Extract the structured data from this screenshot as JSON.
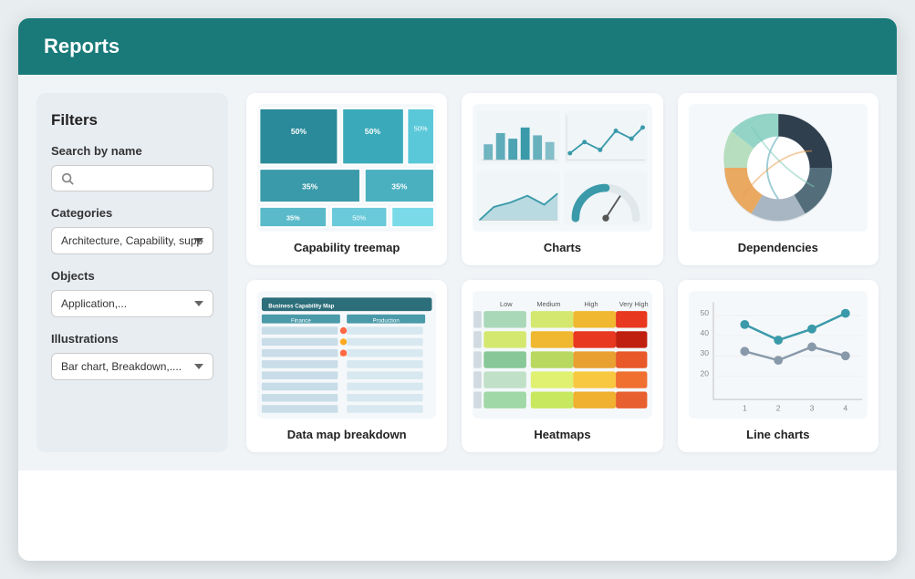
{
  "header": {
    "title": "Reports"
  },
  "sidebar": {
    "title": "Filters",
    "search": {
      "label": "Search by name",
      "placeholder": ""
    },
    "categories": {
      "label": "Categories",
      "value": "Architecture, Capability, support, ..."
    },
    "objects": {
      "label": "Objects",
      "value": "Application,..."
    },
    "illustrations": {
      "label": "Illustrations",
      "value": "Bar chart, Breakdown,...."
    }
  },
  "reports": [
    {
      "id": "capability-treemap",
      "label": "Capability treemap",
      "type": "treemap"
    },
    {
      "id": "charts",
      "label": "Charts",
      "type": "charts"
    },
    {
      "id": "dependencies",
      "label": "Dependencies",
      "type": "dependencies"
    },
    {
      "id": "data-map-breakdown",
      "label": "Data map breakdown",
      "type": "datamap"
    },
    {
      "id": "heatmaps",
      "label": "Heatmaps",
      "type": "heatmap"
    },
    {
      "id": "line-charts",
      "label": "Line charts",
      "type": "linechart"
    }
  ],
  "colors": {
    "header_bg": "#1a7a7a",
    "sidebar_bg": "#e8edf2",
    "card_bg": "#ffffff",
    "treemap_dark": "#1a6a7a",
    "treemap_mid": "#3a9aaa",
    "treemap_light": "#7acada"
  }
}
